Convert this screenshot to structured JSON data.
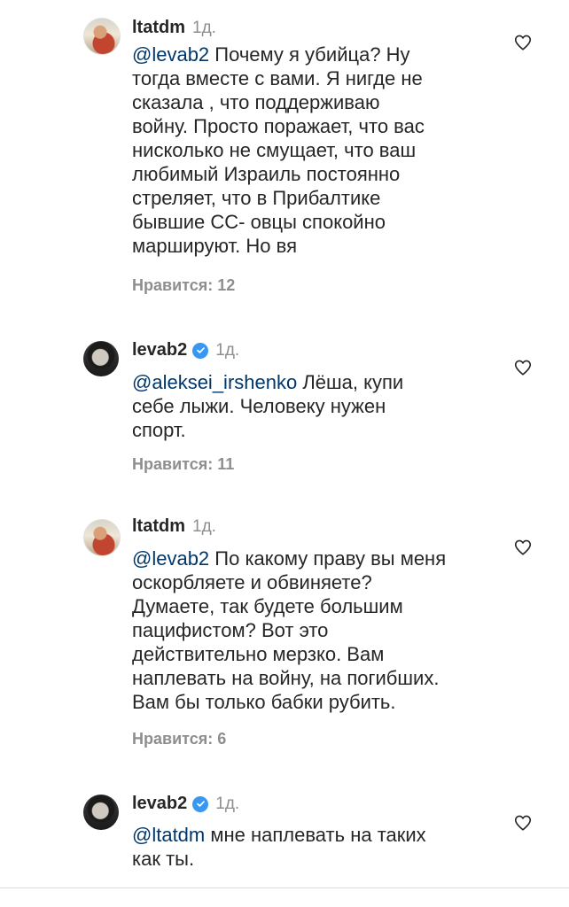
{
  "comments": [
    {
      "username": "ltatdm",
      "time": "1д.",
      "verified": false,
      "mention": "@levab2",
      "text_lines": [
        " Почему я убийца? Ну",
        "тогда вместе с вами. Я нигде не",
        "сказала , что поддерживаю",
        "войну.  Просто поражает, что вас",
        "нисколько не смущает, что ваш",
        "любимый Израиль постоянно",
        "стреляет, что в Прибалтике",
        "бывшие СС- овцы спокойно",
        "маршируют. Но вя"
      ],
      "likes": "Нравится: 12"
    },
    {
      "username": "levab2",
      "time": "1д.",
      "verified": true,
      "mention": "@aleksei_irshenko",
      "text_lines": [
        " Лёша, купи",
        "себе лыжи. Человеку нужен",
        "спорт."
      ],
      "likes": "Нравится: 11"
    },
    {
      "username": "ltatdm",
      "time": "1д.",
      "verified": false,
      "mention": "@levab2",
      "text_lines": [
        " По какому праву вы меня",
        "оскорбляете и обвиняете?",
        "Думаете, так будете большим",
        "пацифистом? Вот это",
        "действительно мерзко. Вам",
        "наплевать на войну, на погибших.",
        "Вам бы только бабки рубить."
      ],
      "likes": "Нравится: 6"
    },
    {
      "username": "levab2",
      "time": "1д.",
      "verified": true,
      "mention": "@ltatdm",
      "text_lines": [
        " мне наплевать на таких",
        "как ты."
      ],
      "likes": ""
    }
  ],
  "icons": {
    "heart": "heart-outline-icon",
    "verified": "verified-badge-icon"
  },
  "colors": {
    "mention": "#00376b",
    "verified": "#3897f0",
    "secondary_text": "#8e8e8e"
  }
}
